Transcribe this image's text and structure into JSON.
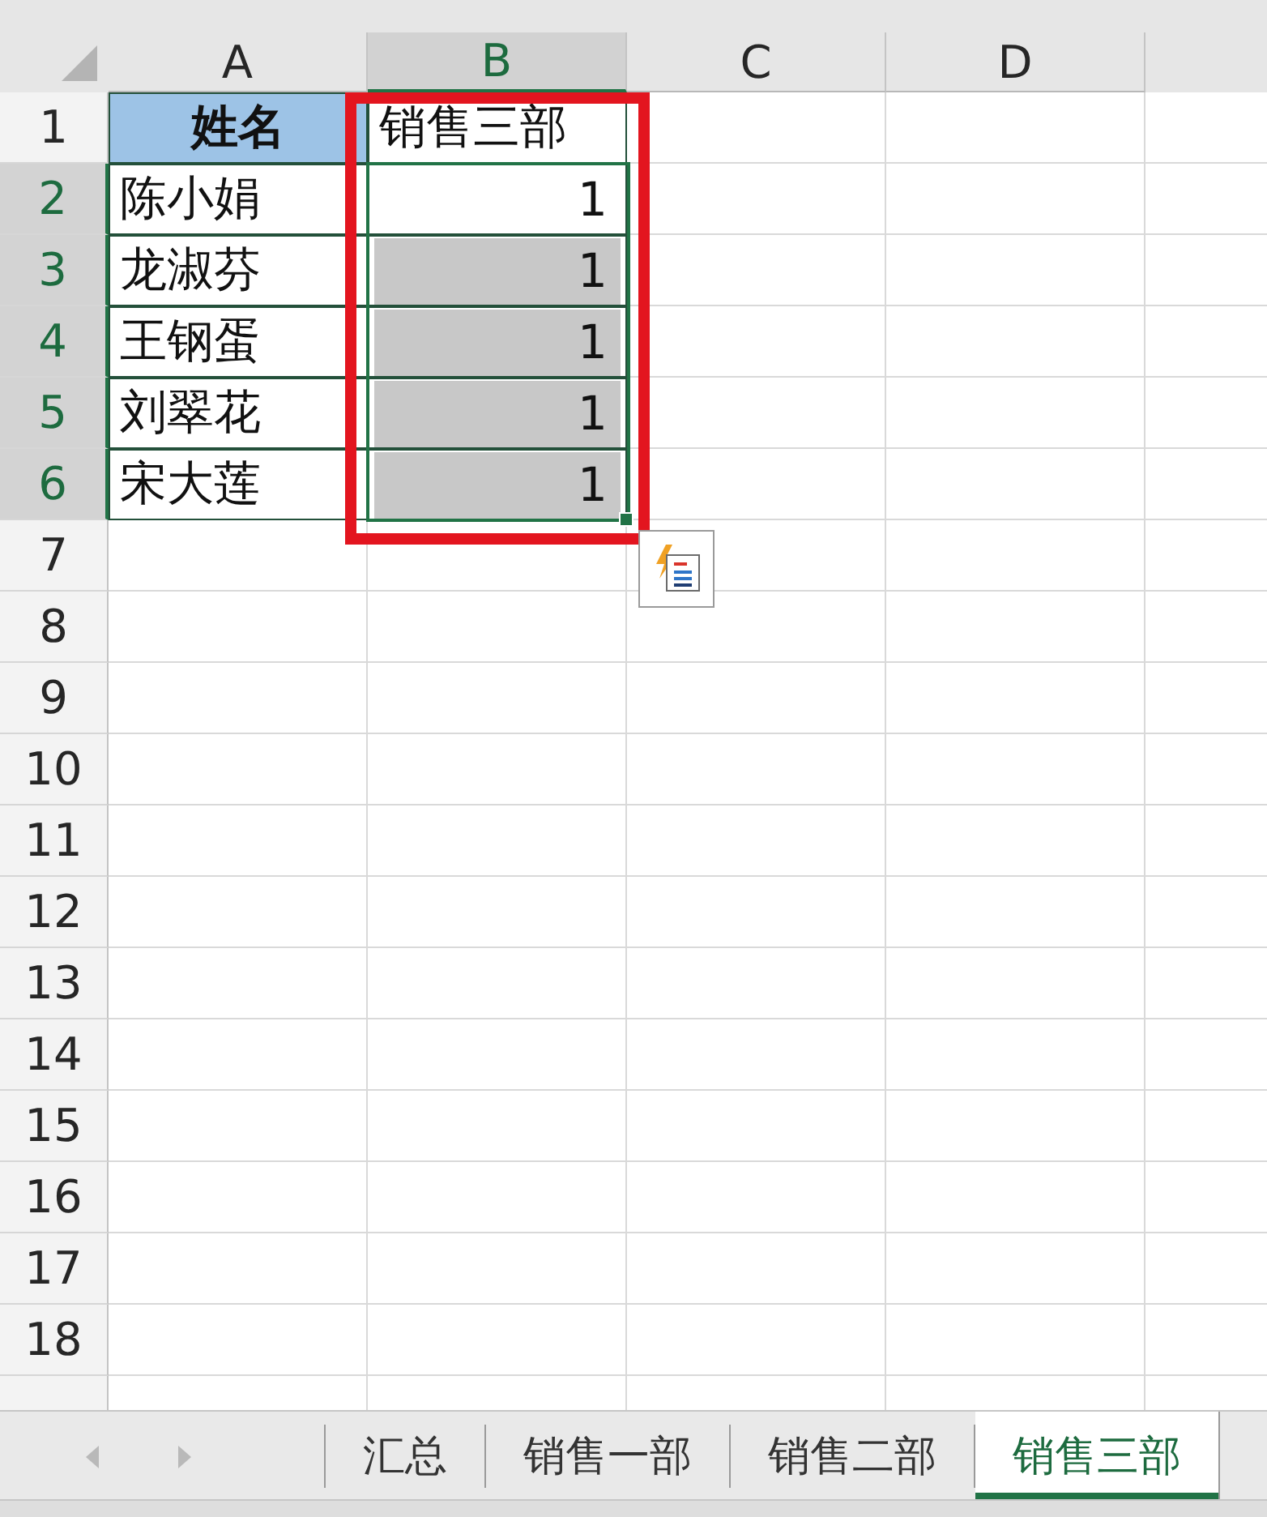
{
  "sheet": {
    "columns": [
      {
        "label": "A",
        "selected": false,
        "outlined": false
      },
      {
        "label": "B",
        "selected": true,
        "outlined": true
      },
      {
        "label": "C",
        "selected": false,
        "outlined": false
      },
      {
        "label": "D",
        "selected": false,
        "outlined": false
      }
    ],
    "rows": [
      {
        "number": "1",
        "selected": false,
        "cells": [
          {
            "kind": "header",
            "text": "姓名",
            "selected": false,
            "active": false
          },
          {
            "kind": "text",
            "text": "销售三部",
            "selected": false,
            "active": false
          }
        ]
      },
      {
        "number": "2",
        "selected": true,
        "cells": [
          {
            "kind": "text",
            "text": "陈小娟",
            "selected": false,
            "active": false
          },
          {
            "kind": "number",
            "text": "1",
            "selected": true,
            "active": true
          }
        ]
      },
      {
        "number": "3",
        "selected": true,
        "cells": [
          {
            "kind": "text",
            "text": "龙淑芬",
            "selected": false,
            "active": false
          },
          {
            "kind": "number",
            "text": "1",
            "selected": true,
            "active": false
          }
        ]
      },
      {
        "number": "4",
        "selected": true,
        "cells": [
          {
            "kind": "text",
            "text": "王钢蛋",
            "selected": false,
            "active": false
          },
          {
            "kind": "number",
            "text": "1",
            "selected": true,
            "active": false
          }
        ]
      },
      {
        "number": "5",
        "selected": true,
        "cells": [
          {
            "kind": "text",
            "text": "刘翠花",
            "selected": false,
            "active": false
          },
          {
            "kind": "number",
            "text": "1",
            "selected": true,
            "active": false
          }
        ]
      },
      {
        "number": "6",
        "selected": true,
        "cells": [
          {
            "kind": "text",
            "text": "宋大莲",
            "selected": false,
            "active": false
          },
          {
            "kind": "number",
            "text": "1",
            "selected": true,
            "active": false
          }
        ]
      },
      {
        "number": "7",
        "selected": false
      },
      {
        "number": "8",
        "selected": false
      },
      {
        "number": "9",
        "selected": false
      },
      {
        "number": "10",
        "selected": false
      },
      {
        "number": "11",
        "selected": false
      },
      {
        "number": "12",
        "selected": false
      },
      {
        "number": "13",
        "selected": false
      },
      {
        "number": "14",
        "selected": false
      },
      {
        "number": "15",
        "selected": false
      },
      {
        "number": "16",
        "selected": false
      },
      {
        "number": "17",
        "selected": false
      },
      {
        "number": "18",
        "selected": false
      },
      {
        "selected": false
      }
    ]
  },
  "sheet_tabs": {
    "navigation": [
      {
        "kind": "previous",
        "disabled": true
      },
      {
        "kind": "next",
        "disabled": true
      }
    ],
    "tabs": [
      {
        "label": "汇总",
        "selected": false
      },
      {
        "label": "销售一部",
        "selected": false
      },
      {
        "label": "销售二部",
        "selected": false
      },
      {
        "label": "销售三部",
        "selected": true
      }
    ]
  }
}
